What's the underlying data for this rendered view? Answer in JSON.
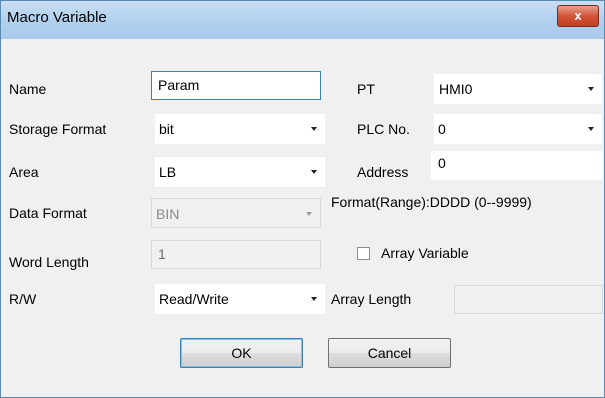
{
  "dialog": {
    "title": "Macro Variable",
    "close_label": "x"
  },
  "fields": {
    "name": {
      "label": "Name",
      "value": "Param"
    },
    "storage_format": {
      "label": "Storage Format",
      "value": "bit"
    },
    "area": {
      "label": "Area",
      "value": "LB"
    },
    "data_format": {
      "label": "Data Format",
      "value": "BIN"
    },
    "word_length": {
      "label": "Word Length",
      "value": "1"
    },
    "rw": {
      "label": "R/W",
      "value": "Read/Write"
    },
    "pt": {
      "label": "PT",
      "value": "HMI0"
    },
    "plc_no": {
      "label": "PLC No.",
      "value": "0"
    },
    "address": {
      "label": "Address",
      "value": "0"
    },
    "format_range": "Format(Range):DDDD (0--9999)",
    "array_variable": {
      "label": "Array Variable",
      "checked": false
    },
    "array_length": {
      "label": "Array Length",
      "value": ""
    }
  },
  "buttons": {
    "ok": "OK",
    "cancel": "Cancel"
  }
}
